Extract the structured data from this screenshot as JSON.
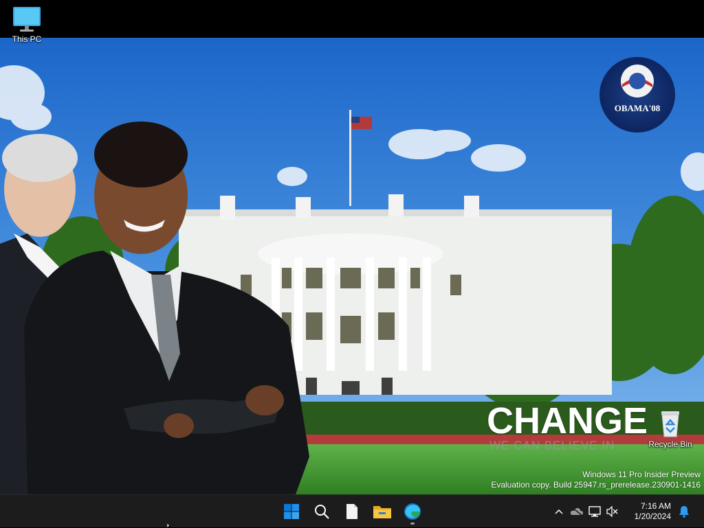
{
  "desktop": {
    "icons": [
      {
        "label": "This PC",
        "icon": "monitor-icon"
      },
      {
        "label": "Recycle Bin",
        "icon": "recycle-bin-icon"
      }
    ],
    "wallpaper": {
      "logo_text": "OBAMA'08",
      "headline": "CHANGE",
      "tagline": "WE CAN BELIEVE IN"
    },
    "watermark": {
      "line1": "Windows 11 Pro Insider Preview",
      "line2": "Evaluation copy. Build 25947.rs_prerelease.230901-1416"
    }
  },
  "taskbar": {
    "apps": [
      {
        "name": "start",
        "icon": "windows-start-icon"
      },
      {
        "name": "search",
        "icon": "search-icon"
      },
      {
        "name": "file",
        "icon": "document-icon"
      },
      {
        "name": "file-explorer",
        "icon": "folder-icon"
      },
      {
        "name": "edge",
        "icon": "edge-browser-icon",
        "running": true
      }
    ],
    "tray": {
      "icons": [
        "chevron-up-icon",
        "onedrive-icon",
        "network-icon",
        "volume-muted-icon"
      ],
      "time": "7:16 AM",
      "date": "1/20/2024",
      "notification_icon": "bell-icon"
    }
  },
  "colors": {
    "taskbar_bg": "#1c1c1c",
    "sky_top": "#1f6fd0",
    "lawn": "#3f9a2e",
    "start_blue": "#0a78d7"
  }
}
